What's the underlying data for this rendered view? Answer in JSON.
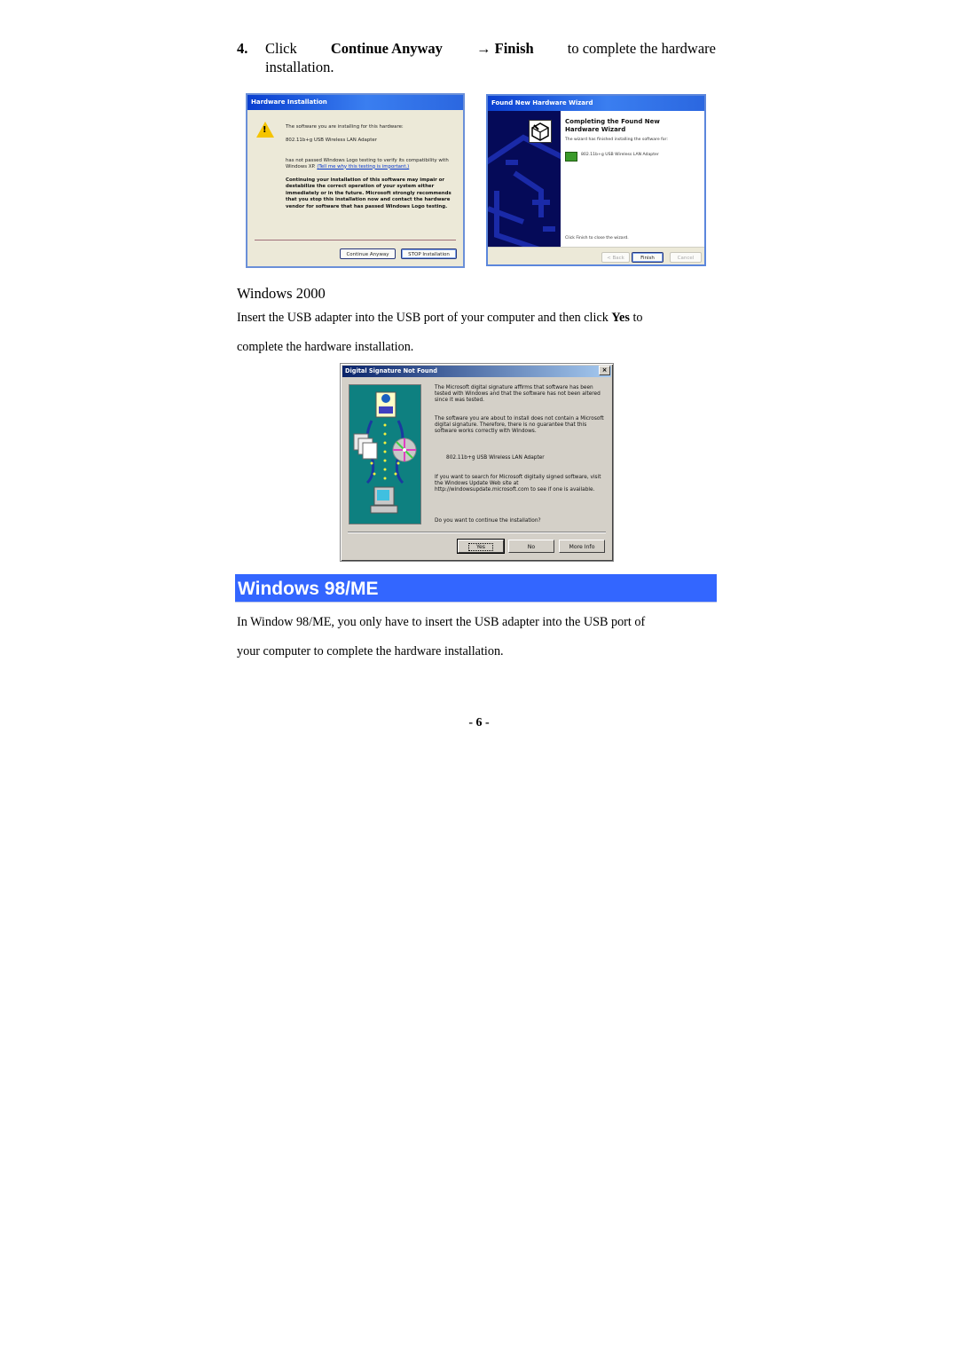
{
  "step4": {
    "number": "4.",
    "click": "Click",
    "continue_anyway": "Continue Anyway",
    "arrow": "→",
    "finish": "Finish",
    "rest": "to complete the hardware",
    "line2": "installation."
  },
  "hardware_installation_dialog": {
    "title": "Hardware Installation",
    "icon": "warning-icon",
    "line1": "The software you are installing for this hardware:",
    "device": "802.11b+g USB Wireless LAN Adapter",
    "line3a": "has not passed Windows Logo testing to verify its compatibility with Windows XP.",
    "line3_link": "(Tell me why this testing is important.)",
    "warning": "Continuing your installation of this software may impair or destabilize the correct operation of your system either immediately or in the future. Microsoft strongly recommends that you stop this installation now and contact the hardware vendor for software that has passed Windows Logo testing.",
    "buttons": {
      "continue": "Continue Anyway",
      "stop": "STOP Installation"
    }
  },
  "found_new_hardware_wizard": {
    "title": "Found New Hardware Wizard",
    "heading_line1": "Completing the Found New",
    "heading_line2": "Hardware Wizard",
    "finished": "The wizard has finished installing the software for:",
    "device": "802.11b+g USB Wireless LAN Adapter",
    "close_hint": "Click Finish to close the wizard.",
    "buttons": {
      "back": "< Back",
      "finish": "Finish",
      "cancel": "Cancel"
    }
  },
  "windows2000": {
    "heading": "Windows 2000",
    "para_line1_a": "Insert the USB adapter into the USB port of your computer and then click",
    "para_line1_bold": "Yes",
    "para_line1_b": "to",
    "para_line2": "complete the hardware installation."
  },
  "digital_signature_dialog": {
    "title": "Digital Signature Not Found",
    "close": "×",
    "p1": "The Microsoft digital signature affirms that software has been tested with Windows and that the software has not been altered since it was tested.",
    "p2": "The software you are about to install does not contain a Microsoft digital signature. Therefore, there is no guarantee that this software works correctly with Windows.",
    "device": "802.11b+g USB Wireless LAN Adapter",
    "p4": "If you want to search for Microsoft digitally signed software, visit the Windows Update Web site at http://windowsupdate.microsoft.com to see if one is available.",
    "question": "Do you want to continue the installation?",
    "buttons": {
      "yes": "Yes",
      "no": "No",
      "more_info": "More Info"
    }
  },
  "windows98me": {
    "banner": "Windows 98/ME",
    "banner_color": "#3366ff",
    "para_line1": "In Window 98/ME, you only have to insert the USB adapter into the USB port of",
    "para_line2": "your computer to complete the hardware installation."
  },
  "page_number": "- 6 -"
}
